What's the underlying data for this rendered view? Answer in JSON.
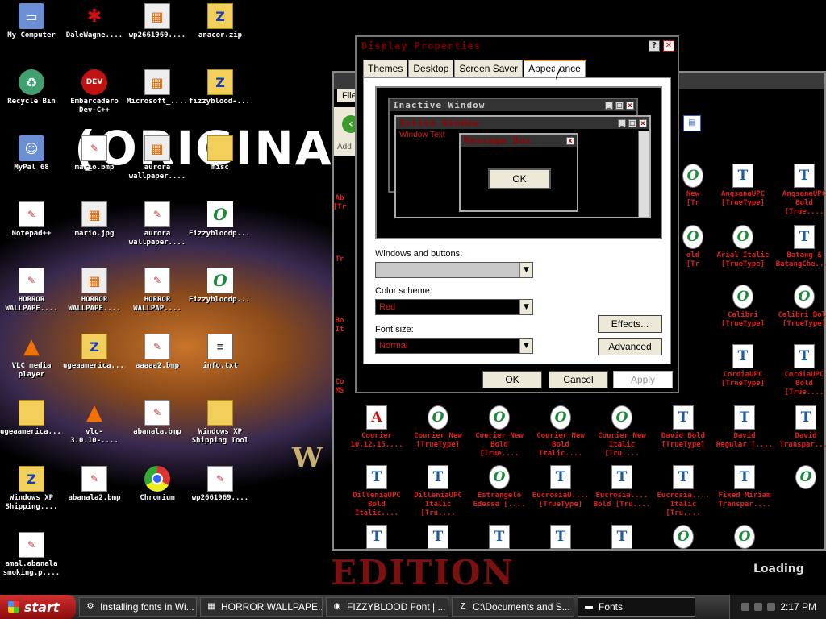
{
  "wallpaper": {
    "title": "(ORIGINAL)",
    "bottom_text": "EDITION",
    "w_text": "W",
    "loading": "Loading"
  },
  "desktop_icons": [
    {
      "label": "My Computer",
      "kind": "pc",
      "glyph": "▭"
    },
    {
      "label": "DaleWagne....",
      "kind": "red",
      "glyph": "✱"
    },
    {
      "label": "wp2661969....",
      "kind": "img",
      "glyph": "▦"
    },
    {
      "label": "anacor.zip",
      "kind": "folder",
      "glyph": "Z"
    },
    {
      "label": "Recycle Bin",
      "kind": "recycle",
      "glyph": "♻"
    },
    {
      "label": "Embarcadero\nDev-C++",
      "kind": "dev",
      "glyph": "DEV"
    },
    {
      "label": "Microsoft_....",
      "kind": "img",
      "glyph": "▦"
    },
    {
      "label": "fizzyblood-....",
      "kind": "folder",
      "glyph": "Z"
    },
    {
      "label": "MyPal 68",
      "kind": "pc",
      "glyph": "☺"
    },
    {
      "label": "mario.bmp",
      "kind": "file",
      "glyph": "✎"
    },
    {
      "label": "aurora\nwallpaper....",
      "kind": "img",
      "glyph": "▦"
    },
    {
      "label": "misc",
      "kind": "folder",
      "glyph": ""
    },
    {
      "label": "Notepad++",
      "kind": "file",
      "glyph": "✎"
    },
    {
      "label": "mario.jpg",
      "kind": "img",
      "glyph": "▦"
    },
    {
      "label": "aurora\nwallpaper....",
      "kind": "file",
      "glyph": "✎"
    },
    {
      "label": "Fizzybloodp....",
      "kind": "opentype",
      "glyph": "O"
    },
    {
      "label": "HORROR\nWALLPAPE....",
      "kind": "file",
      "glyph": "✎"
    },
    {
      "label": "HORROR\nWALLPAPE....",
      "kind": "img",
      "glyph": "▦"
    },
    {
      "label": "HORROR\nWALLPAP....",
      "kind": "file",
      "glyph": "✎"
    },
    {
      "label": "Fizzybloodp....",
      "kind": "opentype",
      "glyph": "O"
    },
    {
      "label": "VLC media\nplayer",
      "kind": "vlc",
      "glyph": "▲"
    },
    {
      "label": "ugeaamerica....",
      "kind": "folder",
      "glyph": "Z"
    },
    {
      "label": "aaaaa2.bmp",
      "kind": "file",
      "glyph": "✎"
    },
    {
      "label": "info.txt",
      "kind": "note",
      "glyph": "≡"
    },
    {
      "label": "ugeaamerica....",
      "kind": "folder",
      "glyph": ""
    },
    {
      "label": "vlc-3.0.10-....",
      "kind": "vlc",
      "glyph": "▲"
    },
    {
      "label": "abanala.bmp",
      "kind": "file",
      "glyph": "✎"
    },
    {
      "label": "Windows XP\nShipping Tool",
      "kind": "folder",
      "glyph": ""
    },
    {
      "label": "Windows XP\nShipping....",
      "kind": "folder",
      "glyph": "Z"
    },
    {
      "label": "abanala2.bmp",
      "kind": "file",
      "glyph": "✎"
    },
    {
      "label": "Chromium",
      "kind": "chrome",
      "glyph": ""
    },
    {
      "label": "wp2661969....",
      "kind": "file",
      "glyph": "✎"
    },
    {
      "label": "amal.abanala\nsmoking.p....",
      "kind": "file",
      "glyph": "✎"
    }
  ],
  "fonts_window": {
    "menu": "File",
    "address": "Add",
    "view_icon": "view-icon",
    "partial_left": [
      {
        "label": "Ab\n[Tr"
      },
      {
        "label": "Tr"
      },
      {
        "label": "Bo\nIt"
      },
      {
        "label": "Co\nMS"
      }
    ],
    "fonts": [
      {
        "label": "New\n[Tr",
        "kind": "ot",
        "glyph": "O"
      },
      {
        "label": "AngsanaUPC\n[TrueType]",
        "kind": "tt",
        "glyph": "T"
      },
      {
        "label": "AngsanaUPC\nBold [True....",
        "kind": "tt",
        "glyph": "T"
      },
      {
        "label": "old\n[Tr",
        "kind": "ot",
        "glyph": "O"
      },
      {
        "label": "Arial Italic\n[TrueType]",
        "kind": "ot",
        "glyph": "O"
      },
      {
        "label": "Batang &\nBatangChe....",
        "kind": "tt",
        "glyph": "T"
      },
      {
        "label": "Calibri\n[TrueType]",
        "kind": "ot",
        "glyph": "O"
      },
      {
        "label": "Calibri Bold\n[TrueType]",
        "kind": "ot",
        "glyph": "O"
      },
      {
        "label": "CordiaUPC\n[TrueType]",
        "kind": "tt",
        "glyph": "T"
      },
      {
        "label": "CordiaUPC\nBold [True....",
        "kind": "tt",
        "glyph": "T"
      },
      {
        "label": "Courier\n10,12,15....",
        "kind": "ps",
        "glyph": "A"
      },
      {
        "label": "Courier New\n[TrueType]",
        "kind": "ot",
        "glyph": "O"
      },
      {
        "label": "Courier New\nBold [True....",
        "kind": "ot",
        "glyph": "O"
      },
      {
        "label": "Courier New\nBold Italic....",
        "kind": "ot",
        "glyph": "O"
      },
      {
        "label": "Courier New\nItalic [Tru....",
        "kind": "ot",
        "glyph": "O"
      },
      {
        "label": "David Bold\n[TrueType]",
        "kind": "tt",
        "glyph": "T"
      },
      {
        "label": "David\nRegular [....",
        "kind": "tt",
        "glyph": "T"
      },
      {
        "label": "David\nTranspar....",
        "kind": "tt",
        "glyph": "T"
      },
      {
        "label": "DilleniaUPC\nBold Italic....",
        "kind": "tt",
        "glyph": "T"
      },
      {
        "label": "DilleniaUPC\nItalic [Tru....",
        "kind": "tt",
        "glyph": "T"
      },
      {
        "label": "Estrangelo\nEdessa [....",
        "kind": "ot",
        "glyph": "O"
      },
      {
        "label": "EucrosiaU....\n[TrueType]",
        "kind": "tt",
        "glyph": "T"
      },
      {
        "label": "Eucrosia....\nBold [Tru....",
        "kind": "tt",
        "glyph": "T"
      },
      {
        "label": "Eucrosia....\nItalic [Tru....",
        "kind": "tt",
        "glyph": "T"
      },
      {
        "label": "Fixed Miriam\nTranspar....",
        "kind": "tt",
        "glyph": "T"
      },
      {
        "label": "",
        "kind": "ot",
        "glyph": "O"
      },
      {
        "label": "",
        "kind": "tt",
        "glyph": "T"
      },
      {
        "label": "",
        "kind": "tt",
        "glyph": "T"
      },
      {
        "label": "",
        "kind": "tt",
        "glyph": "T"
      },
      {
        "label": "",
        "kind": "tt",
        "glyph": "T"
      },
      {
        "label": "",
        "kind": "tt",
        "glyph": "T"
      },
      {
        "label": "",
        "kind": "ot",
        "glyph": "O"
      },
      {
        "label": "",
        "kind": "ot",
        "glyph": "O"
      }
    ]
  },
  "dialog": {
    "title": "Display Properties",
    "help_glyph": "?",
    "close_glyph": "✕",
    "tabs": [
      "Themes",
      "Desktop",
      "Screen Saver",
      "Appearance"
    ],
    "active_tab": "Appearance",
    "preview": {
      "inactive_title": "Inactive Window",
      "active_title": "Active Window",
      "window_text": "Window Text",
      "message_title": "Message Box",
      "ok": "OK"
    },
    "windows_buttons_label": "Windows and buttons:",
    "windows_buttons_value": "",
    "color_scheme_label": "Color scheme:",
    "color_scheme_value": "Red",
    "font_size_label": "Font size:",
    "font_size_value": "Normal",
    "effects": "Effects...",
    "advanced": "Advanced",
    "ok": "OK",
    "cancel": "Cancel",
    "apply": "Apply"
  },
  "taskbar": {
    "start": "start",
    "buttons": [
      {
        "label": "Installing fonts in Wi...",
        "icon": "⚙"
      },
      {
        "label": "HORROR WALLPAPE...",
        "icon": "▦"
      },
      {
        "label": "FIZZYBLOOD Font | ...",
        "icon": "◉"
      },
      {
        "label": "C:\\Documents and S...",
        "icon": "Z"
      },
      {
        "label": "Fonts",
        "icon": "▬"
      }
    ],
    "clock": "2:17 PM"
  },
  "colors": {
    "accent_red": "#d02020",
    "start_green": "#c01818",
    "tab_highlight": "#f0a030"
  }
}
